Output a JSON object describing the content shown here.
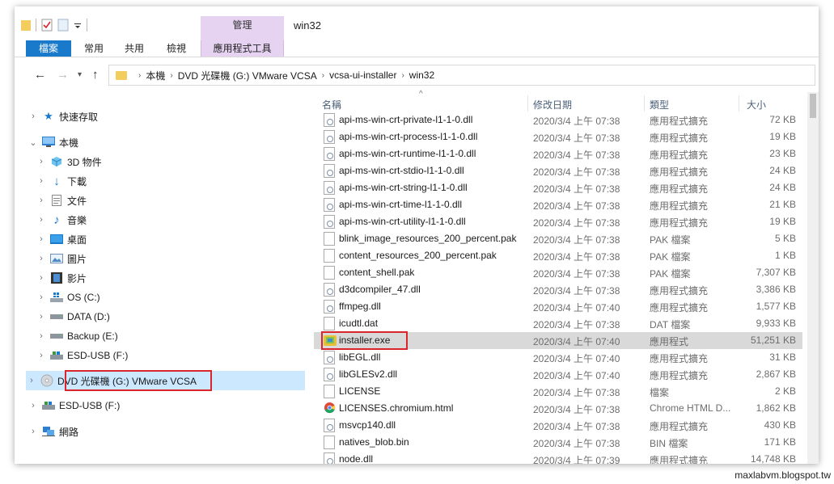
{
  "window": {
    "title": "win32",
    "context_tab_title": "管理"
  },
  "ribbon": {
    "tabs": [
      {
        "label": "檔案"
      },
      {
        "label": "常用"
      },
      {
        "label": "共用"
      },
      {
        "label": "檢視"
      },
      {
        "label": "應用程式工具"
      }
    ]
  },
  "address": {
    "crumbs": [
      {
        "label": "本機"
      },
      {
        "label": "DVD 光碟機 (G:) VMware VCSA"
      },
      {
        "label": "vcsa-ui-installer"
      },
      {
        "label": "win32"
      }
    ]
  },
  "nav": {
    "items": [
      {
        "label": "快速存取",
        "icon": "star-icon"
      },
      {
        "label": "本機",
        "icon": "computer-icon"
      },
      {
        "label": "3D 物件",
        "icon": "3d-objects-icon"
      },
      {
        "label": "下載",
        "icon": "download-icon"
      },
      {
        "label": "文件",
        "icon": "documents-icon"
      },
      {
        "label": "音樂",
        "icon": "music-icon"
      },
      {
        "label": "桌面",
        "icon": "desktop-icon"
      },
      {
        "label": "圖片",
        "icon": "pictures-icon"
      },
      {
        "label": "影片",
        "icon": "videos-icon"
      },
      {
        "label": "OS (C:)",
        "icon": "windows-drive-icon"
      },
      {
        "label": "DATA (D:)",
        "icon": "drive-icon"
      },
      {
        "label": "Backup (E:)",
        "icon": "drive-icon"
      },
      {
        "label": "ESD-USB (F:)",
        "icon": "usb-drive-icon"
      },
      {
        "label": "DVD 光碟機 (G:) VMware VCSA",
        "icon": "dvd-icon"
      },
      {
        "label": "ESD-USB (F:)",
        "icon": "usb-drive-icon"
      },
      {
        "label": "網路",
        "icon": "network-icon"
      }
    ]
  },
  "list": {
    "headers": {
      "name": "名稱",
      "date": "修改日期",
      "type": "類型",
      "size": "大小"
    },
    "rows": [
      {
        "name": "api-ms-win-crt-private-l1-1-0.dll",
        "date": "2020/3/4 上午 07:38",
        "type": "應用程式擴充",
        "size": "72 KB",
        "icon": "dll"
      },
      {
        "name": "api-ms-win-crt-process-l1-1-0.dll",
        "date": "2020/3/4 上午 07:38",
        "type": "應用程式擴充",
        "size": "19 KB",
        "icon": "dll"
      },
      {
        "name": "api-ms-win-crt-runtime-l1-1-0.dll",
        "date": "2020/3/4 上午 07:38",
        "type": "應用程式擴充",
        "size": "23 KB",
        "icon": "dll"
      },
      {
        "name": "api-ms-win-crt-stdio-l1-1-0.dll",
        "date": "2020/3/4 上午 07:38",
        "type": "應用程式擴充",
        "size": "24 KB",
        "icon": "dll"
      },
      {
        "name": "api-ms-win-crt-string-l1-1-0.dll",
        "date": "2020/3/4 上午 07:38",
        "type": "應用程式擴充",
        "size": "24 KB",
        "icon": "dll"
      },
      {
        "name": "api-ms-win-crt-time-l1-1-0.dll",
        "date": "2020/3/4 上午 07:38",
        "type": "應用程式擴充",
        "size": "21 KB",
        "icon": "dll"
      },
      {
        "name": "api-ms-win-crt-utility-l1-1-0.dll",
        "date": "2020/3/4 上午 07:38",
        "type": "應用程式擴充",
        "size": "19 KB",
        "icon": "dll"
      },
      {
        "name": "blink_image_resources_200_percent.pak",
        "date": "2020/3/4 上午 07:38",
        "type": "PAK 檔案",
        "size": "5 KB",
        "icon": "file"
      },
      {
        "name": "content_resources_200_percent.pak",
        "date": "2020/3/4 上午 07:38",
        "type": "PAK 檔案",
        "size": "1 KB",
        "icon": "file"
      },
      {
        "name": "content_shell.pak",
        "date": "2020/3/4 上午 07:38",
        "type": "PAK 檔案",
        "size": "7,307 KB",
        "icon": "file"
      },
      {
        "name": "d3dcompiler_47.dll",
        "date": "2020/3/4 上午 07:38",
        "type": "應用程式擴充",
        "size": "3,386 KB",
        "icon": "dll"
      },
      {
        "name": "ffmpeg.dll",
        "date": "2020/3/4 上午 07:40",
        "type": "應用程式擴充",
        "size": "1,577 KB",
        "icon": "dll"
      },
      {
        "name": "icudtl.dat",
        "date": "2020/3/4 上午 07:38",
        "type": "DAT 檔案",
        "size": "9,933 KB",
        "icon": "file"
      },
      {
        "name": "installer.exe",
        "date": "2020/3/4 上午 07:40",
        "type": "應用程式",
        "size": "51,251 KB",
        "icon": "exe"
      },
      {
        "name": "libEGL.dll",
        "date": "2020/3/4 上午 07:40",
        "type": "應用程式擴充",
        "size": "31 KB",
        "icon": "dll"
      },
      {
        "name": "libGLESv2.dll",
        "date": "2020/3/4 上午 07:40",
        "type": "應用程式擴充",
        "size": "2,867 KB",
        "icon": "dll"
      },
      {
        "name": "LICENSE",
        "date": "2020/3/4 上午 07:38",
        "type": "檔案",
        "size": "2 KB",
        "icon": "file"
      },
      {
        "name": "LICENSES.chromium.html",
        "date": "2020/3/4 上午 07:38",
        "type": "Chrome HTML D...",
        "size": "1,862 KB",
        "icon": "chrome"
      },
      {
        "name": "msvcp140.dll",
        "date": "2020/3/4 上午 07:38",
        "type": "應用程式擴充",
        "size": "430 KB",
        "icon": "dll"
      },
      {
        "name": "natives_blob.bin",
        "date": "2020/3/4 上午 07:38",
        "type": "BIN 檔案",
        "size": "171 KB",
        "icon": "file"
      },
      {
        "name": "node.dll",
        "date": "2020/3/4 上午 07:39",
        "type": "應用程式擴充",
        "size": "14,748 KB",
        "icon": "dll"
      }
    ]
  },
  "watermark": "maxlabvm.blogspot.tw",
  "colors": {
    "accent": "#1979ca",
    "context": "#e6d3f2",
    "highlight": "#d9252b",
    "selected_nav": "#cce8ff"
  }
}
